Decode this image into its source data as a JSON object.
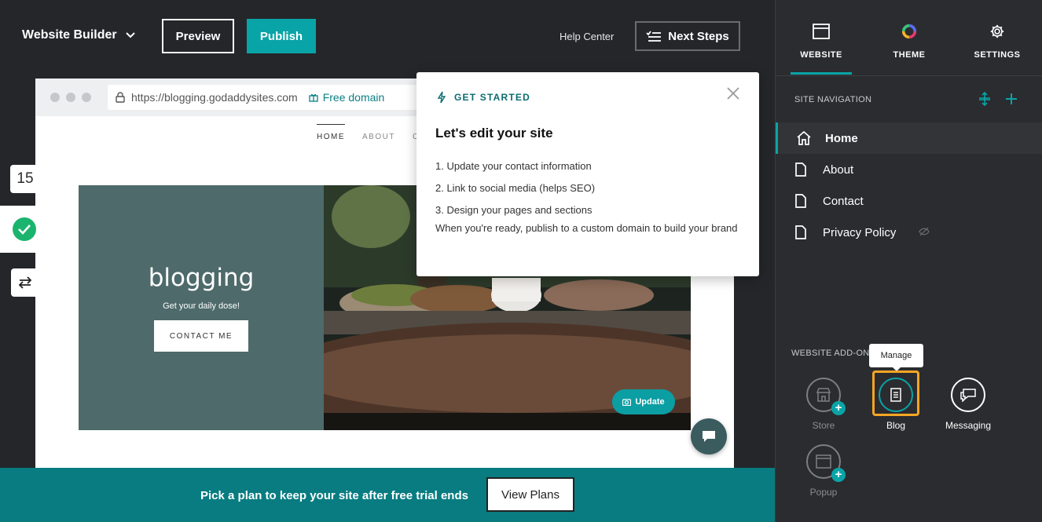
{
  "topbar": {
    "brand": "Website Builder",
    "preview_label": "Preview",
    "publish_label": "Publish",
    "help_label": "Help Center",
    "next_steps_label": "Next Steps"
  },
  "side_tools": {
    "counter": "15"
  },
  "browser": {
    "url": "https://blogging.godaddysites.com",
    "free_domain": "Free domain"
  },
  "site": {
    "nav": [
      "HOME",
      "ABOUT",
      "C"
    ],
    "title": "blogging",
    "subtitle": "Get your daily dose!",
    "cta": "CONTACT ME",
    "update_label": "Update"
  },
  "banner": {
    "text": "Pick a plan to keep your site after free trial ends",
    "button": "View Plans"
  },
  "popover": {
    "kicker": "GET STARTED",
    "title": "Let's edit your site",
    "steps": [
      "1. Update your contact information",
      "2. Link to social media (helps SEO)",
      "3. Design your pages and sections"
    ],
    "footer": "When you're ready, publish to a custom domain to build your brand"
  },
  "panel": {
    "tabs": [
      "WEBSITE",
      "THEME",
      "SETTINGS"
    ],
    "site_nav_label": "SITE NAVIGATION",
    "pages": [
      "Home",
      "About",
      "Contact",
      "Privacy Policy"
    ],
    "addons_label": "WEBSITE ADD-ON",
    "tooltip": "Manage",
    "addons": [
      "Store",
      "Blog",
      "Messaging",
      "Popup"
    ]
  },
  "colors": {
    "accent": "#09a4a7",
    "banner": "#087c80",
    "hero_panel": "#4e6a6b",
    "focus": "#f5a623"
  }
}
